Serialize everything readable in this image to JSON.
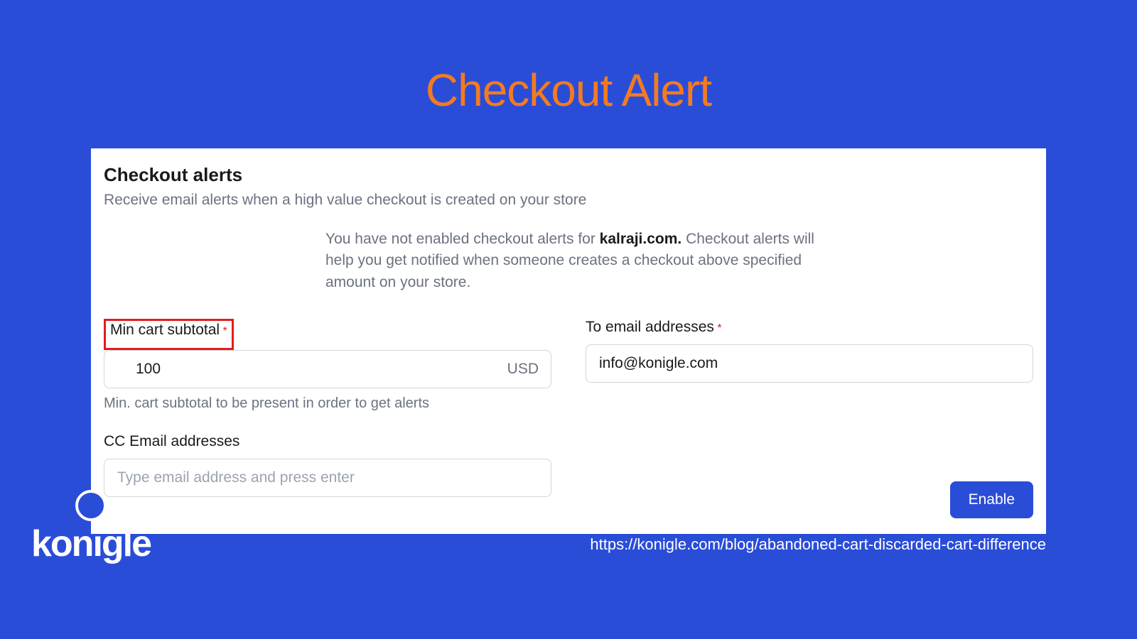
{
  "page_title": "Checkout Alert",
  "card": {
    "title": "Checkout alerts",
    "subtitle": "Receive email alerts when a high value checkout is created on your store",
    "info_prefix": "You have not enabled checkout alerts for ",
    "info_domain": "kalraji.com.",
    "info_suffix": " Checkout alerts will help you get notified when someone creates a checkout above specified amount on your store."
  },
  "fields": {
    "min_subtotal": {
      "label": "Min cart subtotal",
      "value": "100",
      "currency": "USD",
      "helper": "Min. cart subtotal to be present in order to get alerts"
    },
    "to_email": {
      "label": "To email addresses",
      "value": "info@konigle.com"
    },
    "cc_email": {
      "label": "CC Email addresses",
      "placeholder": "Type email address and press enter"
    }
  },
  "enable_button": "Enable",
  "logo": "konigle",
  "footer_url": "https://konigle.com/blog/abandoned-cart-discarded-cart-difference",
  "required_mark": "*"
}
